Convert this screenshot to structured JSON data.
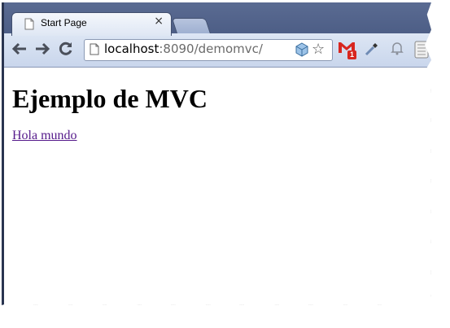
{
  "browser": {
    "tabs": [
      {
        "title": "Start Page",
        "close_glyph": "×"
      }
    ],
    "new_tab_icon": "new-tab-icon",
    "nav_icons": [
      "back-arrow-icon",
      "forward-arrow-icon",
      "reload-icon"
    ],
    "omnibox": {
      "host": "localhost",
      "rest": ":8090/demomvc/"
    },
    "extensions": [
      "gmail-notifier-icon",
      "eyedropper-icon",
      "bell-icon",
      "wrench-menu-icon"
    ],
    "gmail_badge": "1",
    "colors": {
      "titlebar": "#5a6b92",
      "toolbar": "#dde6f4",
      "link_visited": "#551a8b",
      "badge": "#d8261f"
    }
  },
  "page": {
    "heading": "Ejemplo de MVC",
    "link": "Hola mundo"
  }
}
